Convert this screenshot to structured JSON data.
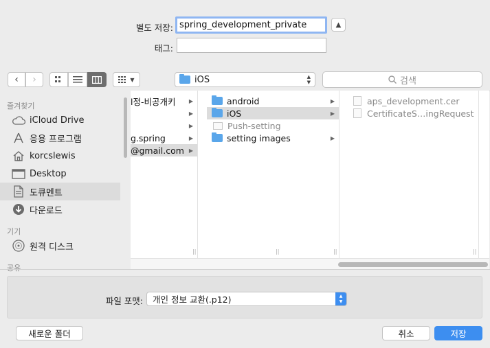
{
  "save_as": {
    "label": "별도 저장:",
    "value": "spring_development_private"
  },
  "tags": {
    "label": "태그:",
    "value": ""
  },
  "toolbar": {
    "location": "iOS",
    "search_placeholder": "검색"
  },
  "sidebar": {
    "favorites_header": "즐겨찾기",
    "favorites": [
      {
        "label": "iCloud Drive",
        "icon": "cloud-icon"
      },
      {
        "label": "응용 프로그램",
        "icon": "applications-icon"
      },
      {
        "label": "korcslewis",
        "icon": "home-icon"
      },
      {
        "label": "Desktop",
        "icon": "desktop-icon"
      },
      {
        "label": "도큐멘트",
        "icon": "documents-icon",
        "selected": true
      },
      {
        "label": "다운로드",
        "icon": "downloads-icon"
      }
    ],
    "devices_header": "기기",
    "devices": [
      {
        "label": "원격 디스크",
        "icon": "disc-icon"
      }
    ],
    "shared_header": "공유"
  },
  "columns": {
    "col1": [
      {
        "label": "l정-비공개키",
        "arrow": true
      },
      {
        "label": "",
        "arrow": true
      },
      {
        "label": "",
        "arrow": true
      },
      {
        "label": "g.spring",
        "arrow": true
      },
      {
        "label": "@gmail.com",
        "arrow": true,
        "selected": true
      }
    ],
    "col2": [
      {
        "label": "android",
        "type": "folder",
        "arrow": true
      },
      {
        "label": "iOS",
        "type": "folder",
        "arrow": true,
        "selected": true
      },
      {
        "label": "Push-setting",
        "type": "doc",
        "dim": true
      },
      {
        "label": "setting images",
        "type": "folder",
        "arrow": true
      }
    ],
    "col3": [
      {
        "label": "aps_development.cer",
        "type": "doc",
        "dim": true
      },
      {
        "label": "CertificateS…ingRequest",
        "type": "doc",
        "dim": true
      }
    ]
  },
  "format": {
    "label": "파일 포맷:",
    "value": "개인 정보 교환(.p12)"
  },
  "buttons": {
    "new_folder": "새로운 폴더",
    "cancel": "취소",
    "save": "저장"
  },
  "colors": {
    "accent": "#3d8ef0",
    "folder": "#5aa6ea",
    "selection": "#dcdcdc"
  }
}
